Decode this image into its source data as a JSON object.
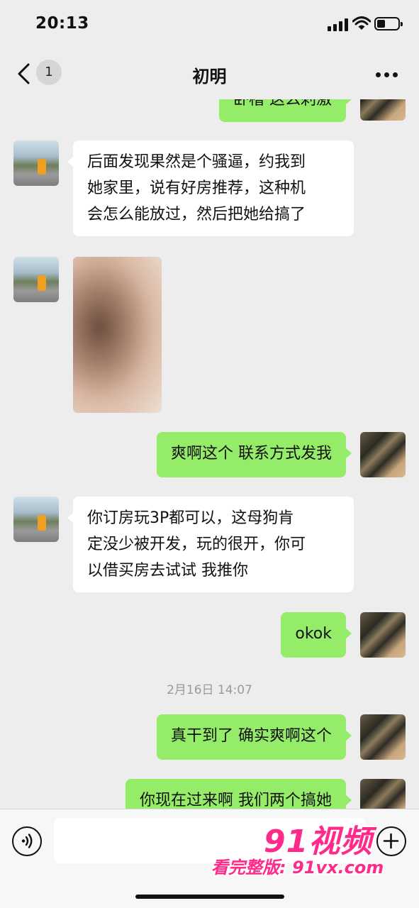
{
  "status_bar": {
    "time": "20:13"
  },
  "nav": {
    "back_badge": "1",
    "title": "初明"
  },
  "messages": {
    "m0_partial": "卧槽 这么刺激",
    "m1": "后面发现果然是个骚逼，约我到\n她家里，说有好房推荐，这种机\n会怎么能放过，然后把她给搞了",
    "m3": "爽啊这个 联系方式发我",
    "m4": "你订房玩3P都可以，这母狗肯\n定没少被开发，玩的很开，你可\n以借买房去试试 我推你",
    "m5": "okok",
    "timestamp": "2月16日 14:07",
    "m6": "真干到了 确实爽啊这个",
    "m7_partial": "你现在过来啊 我们两个搞她"
  },
  "input": {
    "placeholder": ""
  },
  "watermark": {
    "logo": "91视频",
    "url": "看完整版: 91vx.com"
  },
  "colors": {
    "background": "#ededed",
    "bubble_out": "#95ec69",
    "bubble_in": "#ffffff",
    "watermark": "#ff2a8a"
  },
  "icons": [
    "back-chevron-icon",
    "more-dots-icon",
    "voice-icon",
    "plus-icon",
    "signal-icon",
    "wifi-icon",
    "battery-icon"
  ]
}
